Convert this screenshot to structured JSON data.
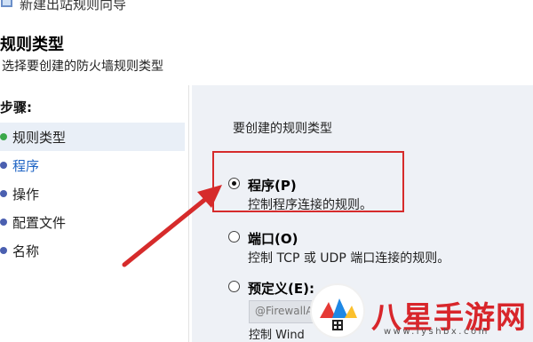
{
  "window": {
    "title": "新建出站规则向导"
  },
  "header": {
    "title": "规则类型",
    "subtitle": "选择要创建的防火墙规则类型"
  },
  "steps": {
    "heading": "步骤:",
    "items": [
      {
        "label": "规则类型",
        "state": "current"
      },
      {
        "label": "程序",
        "state": "link"
      },
      {
        "label": "操作",
        "state": "pending"
      },
      {
        "label": "配置文件",
        "state": "pending"
      },
      {
        "label": "名称",
        "state": "pending"
      }
    ]
  },
  "panel": {
    "heading": "要创建的规则类型",
    "options": [
      {
        "label": "程序(P)",
        "description": "控制程序连接的规则。",
        "checked": true
      },
      {
        "label": "端口(O)",
        "description": "控制 TCP 或 UDP 端口连接的规则。",
        "checked": false
      },
      {
        "label": "预定义(E):",
        "description": "控制 Windows 体验功能连接的规则。",
        "checked": false
      }
    ],
    "predefined_placeholder": "@FirewallAPI.dll",
    "predefined_desc_visible": "控制 Wind"
  },
  "annotation": {
    "highlight_color": "#d62b2b"
  },
  "watermark": {
    "name": "八星手游网",
    "url": "www.lyshbx.com"
  }
}
